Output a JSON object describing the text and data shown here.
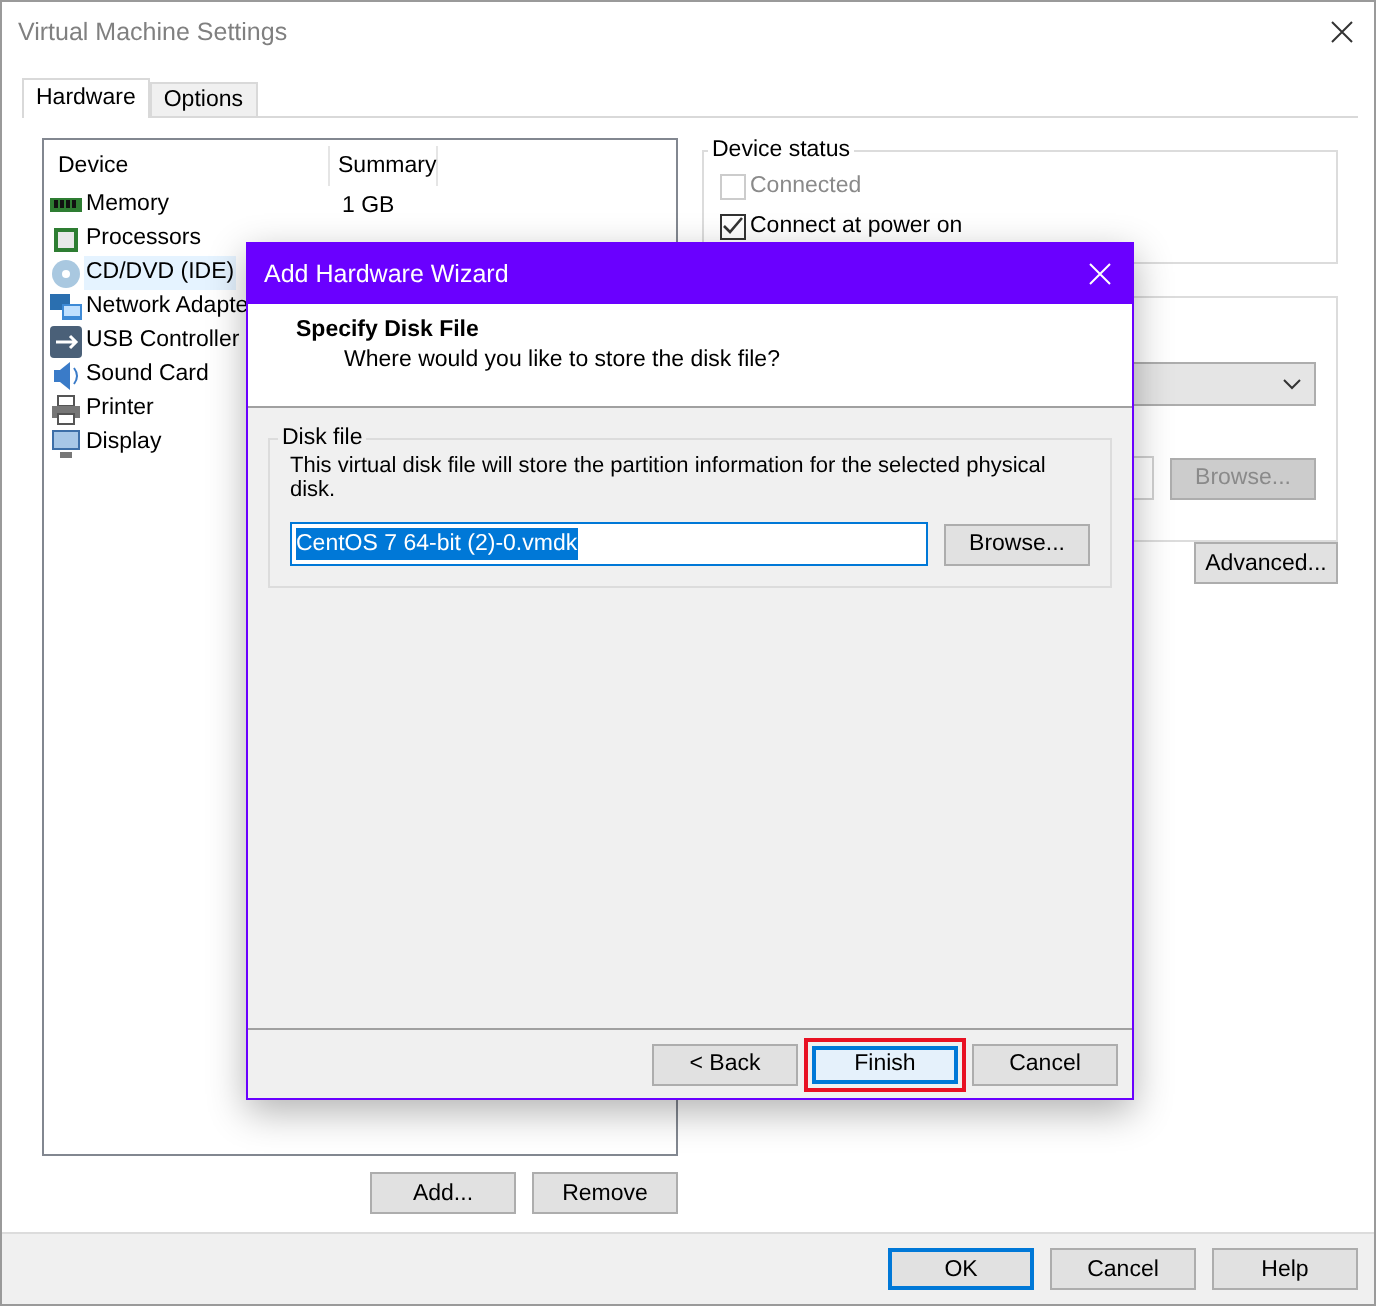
{
  "window": {
    "title": "Virtual Machine Settings"
  },
  "tabs": [
    {
      "label": "Hardware",
      "selected": true
    },
    {
      "label": "Options",
      "selected": false
    }
  ],
  "device_table": {
    "columns": [
      "Device",
      "Summary"
    ],
    "rows": [
      {
        "device": "Memory",
        "summary": "1 GB",
        "selected": false
      },
      {
        "device": "Processors",
        "selected": false
      },
      {
        "device": "CD/DVD (IDE)",
        "selected": true
      },
      {
        "device": "Network Adapte",
        "selected": false
      },
      {
        "device": "USB Controller",
        "selected": false
      },
      {
        "device": "Sound Card",
        "selected": false
      },
      {
        "device": "Printer",
        "selected": false
      },
      {
        "device": "Display",
        "selected": false
      }
    ]
  },
  "device_buttons": [
    "Add...",
    "Remove"
  ],
  "device_status": {
    "title": "Device status",
    "options": [
      {
        "label": "Connected",
        "checked": false,
        "disabled": true
      },
      {
        "label": "Connect at power on",
        "checked": true,
        "disabled": false
      }
    ]
  },
  "connection": {
    "browse_button": {
      "label": "Browse...",
      "disabled": true
    }
  },
  "advanced_button": "Advanced...",
  "footer_buttons": [
    {
      "label": "OK",
      "default": true
    },
    {
      "label": "Cancel",
      "default": false
    },
    {
      "label": "Help",
      "default": false
    }
  ],
  "dialog": {
    "title": "Add Hardware Wizard",
    "heading": "Specify Disk File",
    "subheading": "Where would you like to store the disk file?",
    "group": {
      "title": "Disk file",
      "description": "This virtual disk file will store the partition information for the selected physical disk.",
      "value": "CentOS 7 64-bit (2)-0.vmdk",
      "value_selected": true,
      "browse": "Browse..."
    },
    "buttons": [
      {
        "label": "< Back",
        "default": false,
        "highlighted": false
      },
      {
        "label": "Finish",
        "default": true,
        "highlighted": true
      },
      {
        "label": "Cancel",
        "default": false,
        "highlighted": false
      }
    ]
  }
}
